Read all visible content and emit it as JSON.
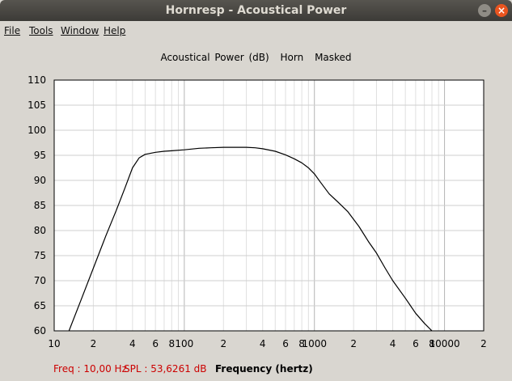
{
  "window": {
    "title": "Hornresp - Acoustical Power",
    "minimize_glyph": "–",
    "close_glyph": "×"
  },
  "menu": [
    "File",
    "Tools",
    "Window",
    "Help"
  ],
  "chart_title_parts": [
    "Acoustical Power (dB)",
    "Horn",
    "Masked"
  ],
  "status": {
    "freq": "Freq : 10,00 Hz",
    "spl": "SPL : 53,6261 dB",
    "xlabel": "Frequency (hertz)"
  },
  "chart_data": {
    "type": "line",
    "title": "Acoustical Power (dB)   Horn   Masked",
    "xlabel": "Frequency (hertz)",
    "ylabel": "",
    "xscale": "log",
    "xlim": [
      10,
      20000
    ],
    "ylim": [
      60,
      110
    ],
    "grid": true,
    "y_ticks": [
      "60",
      "65",
      "70",
      "75",
      "80",
      "85",
      "90",
      "95",
      "100",
      "105",
      "110"
    ],
    "x_tick_labels": [
      {
        "f": 10,
        "label": "10"
      },
      {
        "f": 20,
        "label": "2"
      },
      {
        "f": 40,
        "label": "4"
      },
      {
        "f": 60,
        "label": "6"
      },
      {
        "f": 80,
        "label": "8"
      },
      {
        "f": 100,
        "label": "100"
      },
      {
        "f": 200,
        "label": "2"
      },
      {
        "f": 400,
        "label": "4"
      },
      {
        "f": 600,
        "label": "6"
      },
      {
        "f": 800,
        "label": "8"
      },
      {
        "f": 1000,
        "label": "1000"
      },
      {
        "f": 2000,
        "label": "2"
      },
      {
        "f": 4000,
        "label": "4"
      },
      {
        "f": 6000,
        "label": "6"
      },
      {
        "f": 8000,
        "label": "8"
      },
      {
        "f": 10000,
        "label": "10000"
      },
      {
        "f": 20000,
        "label": "2"
      }
    ],
    "series": [
      {
        "color": "#000000",
        "x": [
          13,
          16,
          20,
          25,
          30,
          35,
          40,
          45,
          50,
          60,
          70,
          80,
          100,
          130,
          160,
          200,
          250,
          300,
          350,
          400,
          500,
          600,
          700,
          800,
          900,
          1000,
          1100,
          1300,
          1500,
          1800,
          2200,
          2600,
          3000,
          3500,
          4000,
          5000,
          6000,
          7000,
          8000,
          9000
        ],
        "y": [
          60,
          66,
          72.5,
          79,
          84,
          88.5,
          92.5,
          94.5,
          95.2,
          95.6,
          95.8,
          95.9,
          96.1,
          96.4,
          96.5,
          96.6,
          96.6,
          96.6,
          96.5,
          96.3,
          95.8,
          95.1,
          94.3,
          93.5,
          92.5,
          91.3,
          89.8,
          87.3,
          85.8,
          83.8,
          80.8,
          77.8,
          75.5,
          72.5,
          70,
          66.5,
          63.5,
          61.5,
          60,
          58.3
        ]
      }
    ]
  }
}
